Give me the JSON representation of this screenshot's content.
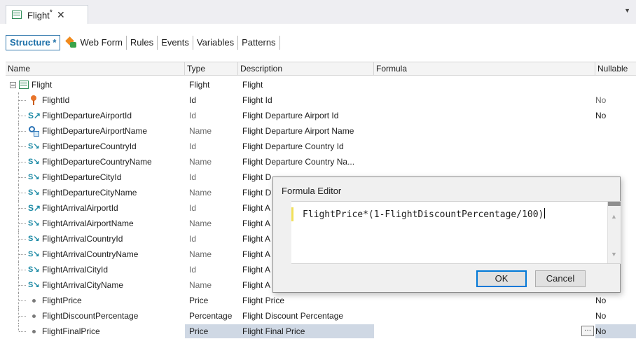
{
  "document_tab": {
    "title": "Flight",
    "modified": "*",
    "close": "✕"
  },
  "strip_dropdown": "▼",
  "subtabs": [
    {
      "label": "Structure *",
      "active": true
    },
    {
      "label": "Web Form",
      "active": false
    },
    {
      "label": "Rules",
      "active": false
    },
    {
      "label": "Events",
      "active": false
    },
    {
      "label": "Variables",
      "active": false
    },
    {
      "label": "Patterns",
      "active": false
    }
  ],
  "columns": {
    "name": "Name",
    "type": "Type",
    "description": "Description",
    "formula": "Formula",
    "nullable": "Nullable"
  },
  "rows": [
    {
      "name": "Flight",
      "type": "Flight",
      "description": "Flight",
      "nullable": "",
      "icon": "transaction-icon"
    },
    {
      "name": "FlightId",
      "type": "Id",
      "description": "Flight Id",
      "nullable": "No",
      "icon": "key-icon"
    },
    {
      "name": "FlightDepartureAirportId",
      "type": "Id",
      "description": "Flight Departure Airport Id",
      "nullable": "No",
      "icon": "subtype-foreign-key-icon"
    },
    {
      "name": "FlightDepartureAirportName",
      "type": "Name",
      "description": "Flight Departure Airport Name",
      "nullable": "",
      "icon": "description-attribute-icon"
    },
    {
      "name": "FlightDepartureCountryId",
      "type": "Id",
      "description": "Flight Departure Country Id",
      "nullable": "",
      "icon": "subtype-inferred-icon"
    },
    {
      "name": "FlightDepartureCountryName",
      "type": "Name",
      "description": "Flight Departure Country Na...",
      "nullable": "",
      "icon": "subtype-inferred-icon"
    },
    {
      "name": "FlightDepartureCityId",
      "type": "Id",
      "description": "Flight D",
      "nullable": "",
      "icon": "subtype-inferred-icon"
    },
    {
      "name": "FlightDepartureCityName",
      "type": "Name",
      "description": "Flight D",
      "nullable": "",
      "icon": "subtype-inferred-icon"
    },
    {
      "name": "FlightArrivalAirportId",
      "type": "Id",
      "description": "Flight A",
      "nullable": "",
      "icon": "subtype-foreign-key-icon"
    },
    {
      "name": "FlightArrivalAirportName",
      "type": "Name",
      "description": "Flight A",
      "nullable": "",
      "icon": "subtype-inferred-icon"
    },
    {
      "name": "FlightArrivalCountryId",
      "type": "Id",
      "description": "Flight A",
      "nullable": "",
      "icon": "subtype-inferred-icon"
    },
    {
      "name": "FlightArrivalCountryName",
      "type": "Name",
      "description": "Flight A",
      "nullable": "",
      "icon": "subtype-inferred-icon"
    },
    {
      "name": "FlightArrivalCityId",
      "type": "Id",
      "description": "Flight A",
      "nullable": "",
      "icon": "subtype-inferred-icon"
    },
    {
      "name": "FlightArrivalCityName",
      "type": "Name",
      "description": "Flight A",
      "nullable": "",
      "icon": "subtype-inferred-icon"
    },
    {
      "name": "FlightPrice",
      "type": "Price",
      "description": "Flight Price",
      "nullable": "No",
      "icon": "attribute-dot-icon"
    },
    {
      "name": "FlightDiscountPercentage",
      "type": "Percentage",
      "description": "Flight Discount Percentage",
      "nullable": "No",
      "icon": "attribute-dot-icon"
    },
    {
      "name": "FlightFinalPrice",
      "type": "Price",
      "description": "Flight Final Price",
      "nullable": "No",
      "icon": "attribute-dot-icon",
      "selected": true
    }
  ],
  "ellipsis": "···",
  "formula_editor": {
    "title": "Formula Editor",
    "formula": "FlightPrice*(1-FlightDiscountPercentage/100)",
    "ok_label": "OK",
    "cancel_label": "Cancel"
  }
}
